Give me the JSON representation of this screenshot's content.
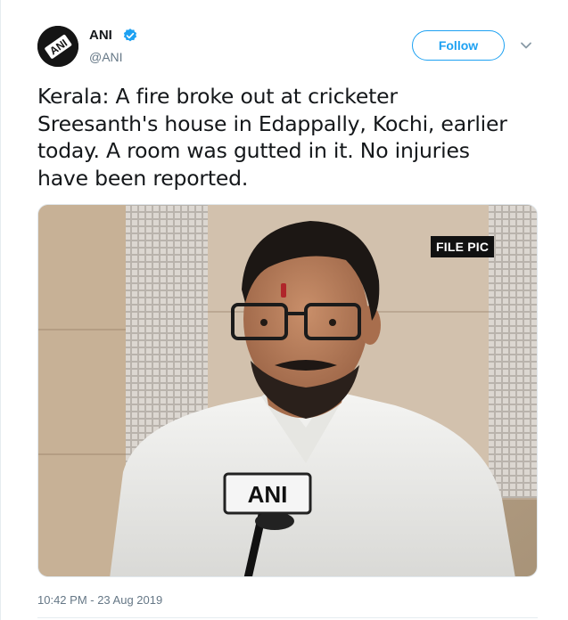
{
  "author": {
    "name": "ANI",
    "handle": "@ANI",
    "verified": true,
    "avatar_icon": "ani-logo-icon",
    "avatar_text": "ANI"
  },
  "actions": {
    "follow_label": "Follow",
    "more_icon": "chevron-down-icon"
  },
  "tweet": {
    "text_lines": [
      "Kerala: A fire broke out at cricketer",
      "Sreesanth's house in Edappally, Kochi, earlier",
      "today. A room was gutted in it. No injuries",
      "have been reported."
    ],
    "media": {
      "overlay_label": "FILE PIC",
      "mic_label": "ANI"
    },
    "timestamp": "10:42 PM - 23 Aug 2019"
  },
  "colors": {
    "accent": "#1da1f2",
    "text": "#14171a",
    "muted": "#657786"
  }
}
